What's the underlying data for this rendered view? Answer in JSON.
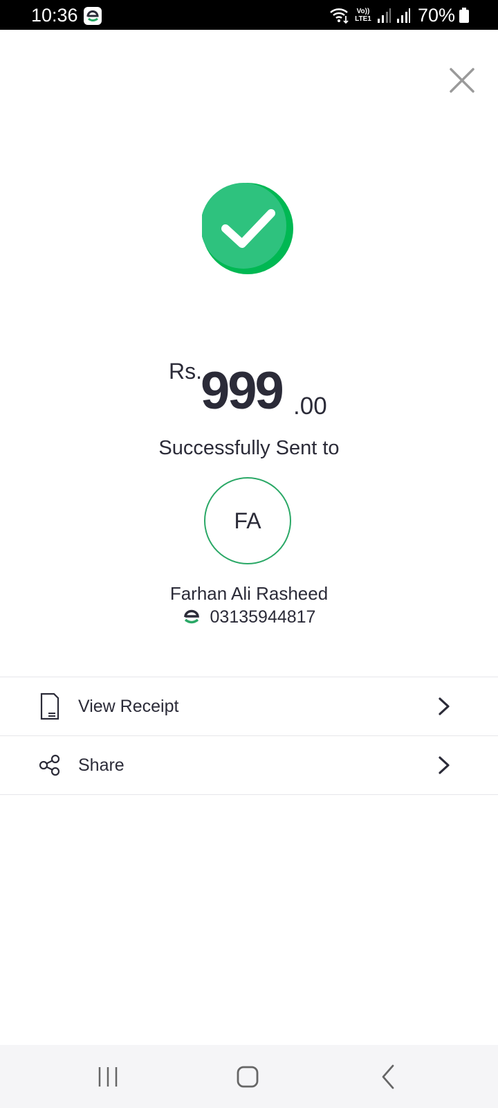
{
  "status_bar": {
    "time": "10:36",
    "network_label": "Vo)) LTE1",
    "battery": "70%"
  },
  "colors": {
    "accent": "#2aa866",
    "check_bg": "#2ec27e",
    "text": "#2b2b38"
  },
  "header": {
    "close_icon": "close-icon"
  },
  "transaction": {
    "currency": "Rs.",
    "amount_major": "999",
    "amount_minor": ".00",
    "status_text": "Successfully Sent to"
  },
  "recipient": {
    "initials": "FA",
    "name": "Farhan Ali Rasheed",
    "phone": "03135944817"
  },
  "actions": [
    {
      "label": "View Receipt",
      "icon": "receipt-icon"
    },
    {
      "label": "Share",
      "icon": "share-icon"
    }
  ],
  "nav_bar": {
    "buttons": [
      "recent-apps-icon",
      "home-icon",
      "back-icon"
    ]
  }
}
